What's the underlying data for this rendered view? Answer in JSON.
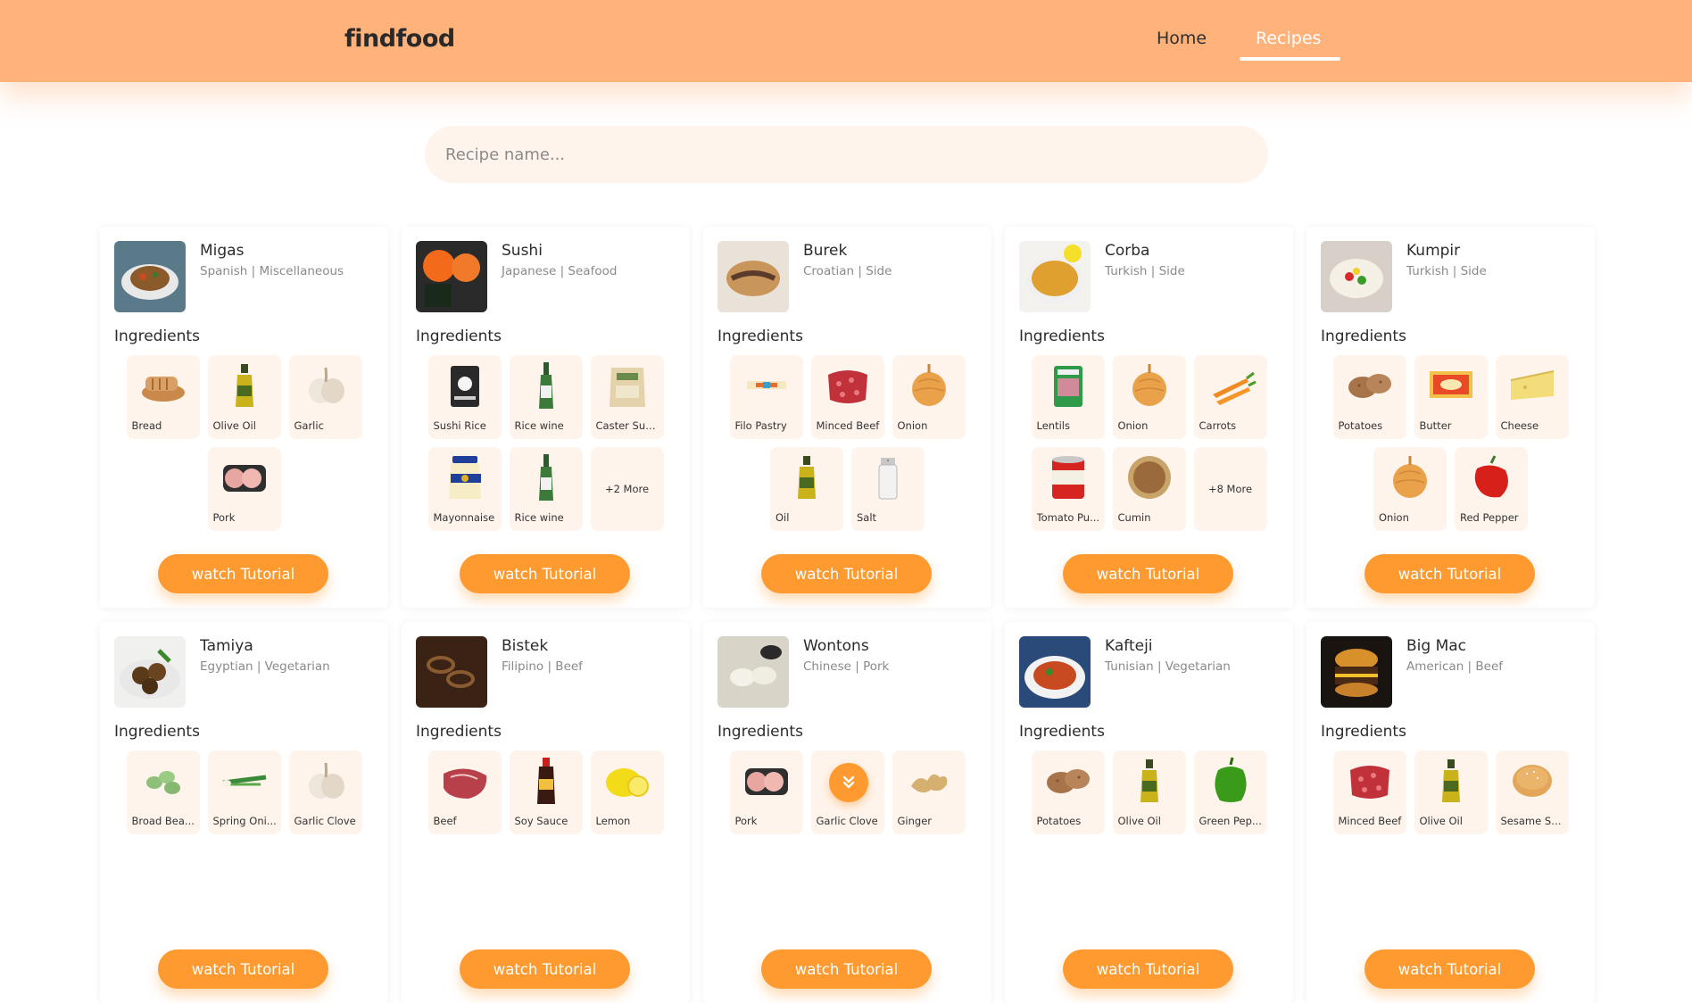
{
  "header": {
    "logo": "findfood",
    "nav": [
      {
        "label": "Home",
        "active": false
      },
      {
        "label": "Recipes",
        "active": true
      }
    ]
  },
  "search": {
    "placeholder": "Recipe name..."
  },
  "ingredients_heading": "Ingredients",
  "tutorial_label": "watch Tutorial",
  "recipes": [
    {
      "name": "Migas",
      "meta": "Spanish | Miscellaneous",
      "image": "migas-dish",
      "ingredients": [
        {
          "label": "Bread",
          "icon": "bread"
        },
        {
          "label": "Olive Oil",
          "icon": "olive-oil"
        },
        {
          "label": "Garlic",
          "icon": "garlic"
        },
        {
          "label": "Pork",
          "icon": "pork"
        }
      ]
    },
    {
      "name": "Sushi",
      "meta": "Japanese | Seafood",
      "image": "sushi-dish",
      "ingredients": [
        {
          "label": "Sushi Rice",
          "icon": "sushi-rice"
        },
        {
          "label": "Rice wine",
          "icon": "rice-wine"
        },
        {
          "label": "Caster Sug...",
          "icon": "sugar-bag"
        },
        {
          "label": "Mayonnaise",
          "icon": "mayonnaise"
        },
        {
          "label": "Rice wine",
          "icon": "rice-wine"
        },
        {
          "label": "+2 More",
          "icon": "more"
        }
      ]
    },
    {
      "name": "Burek",
      "meta": "Croatian | Side",
      "image": "burek-dish",
      "ingredients": [
        {
          "label": "Filo Pastry",
          "icon": "filo"
        },
        {
          "label": "Minced Beef",
          "icon": "minced-beef"
        },
        {
          "label": "Onion",
          "icon": "onion"
        },
        {
          "label": "Oil",
          "icon": "olive-oil"
        },
        {
          "label": "Salt",
          "icon": "salt"
        }
      ]
    },
    {
      "name": "Corba",
      "meta": "Turkish | Side",
      "image": "corba-dish",
      "ingredients": [
        {
          "label": "Lentils",
          "icon": "lentils"
        },
        {
          "label": "Onion",
          "icon": "onion"
        },
        {
          "label": "Carrots",
          "icon": "carrots"
        },
        {
          "label": "Tomato Pu...",
          "icon": "tomato-can"
        },
        {
          "label": "Cumin",
          "icon": "cumin"
        },
        {
          "label": "+8 More",
          "icon": "more"
        }
      ]
    },
    {
      "name": "Kumpir",
      "meta": "Turkish | Side",
      "image": "kumpir-dish",
      "ingredients": [
        {
          "label": "Potatoes",
          "icon": "potatoes"
        },
        {
          "label": "Butter",
          "icon": "butter"
        },
        {
          "label": "Cheese",
          "icon": "cheese"
        },
        {
          "label": "Onion",
          "icon": "onion"
        },
        {
          "label": "Red Pepper",
          "icon": "red-pepper"
        }
      ]
    },
    {
      "name": "Tamiya",
      "meta": "Egyptian | Vegetarian",
      "image": "tamiya-dish",
      "ingredients": [
        {
          "label": "Broad Bea...",
          "icon": "broad-beans"
        },
        {
          "label": "Spring Oni...",
          "icon": "spring-onion"
        },
        {
          "label": "Garlic Clove",
          "icon": "garlic"
        }
      ]
    },
    {
      "name": "Bistek",
      "meta": "Filipino | Beef",
      "image": "bistek-dish",
      "ingredients": [
        {
          "label": "Beef",
          "icon": "beef"
        },
        {
          "label": "Soy Sauce",
          "icon": "soy-sauce"
        },
        {
          "label": "Lemon",
          "icon": "lemon"
        }
      ]
    },
    {
      "name": "Wontons",
      "meta": "Chinese | Pork",
      "image": "wontons-dish",
      "ingredients": [
        {
          "label": "Pork",
          "icon": "pork"
        },
        {
          "label": "Garlic Clove",
          "icon": "garlic"
        },
        {
          "label": "Ginger",
          "icon": "ginger"
        }
      ]
    },
    {
      "name": "Kafteji",
      "meta": "Tunisian | Vegetarian",
      "image": "kafteji-dish",
      "ingredients": [
        {
          "label": "Potatoes",
          "icon": "potatoes"
        },
        {
          "label": "Olive Oil",
          "icon": "olive-oil"
        },
        {
          "label": "Green Pep...",
          "icon": "green-pepper"
        }
      ]
    },
    {
      "name": "Big Mac",
      "meta": "American | Beef",
      "image": "big-mac-dish",
      "ingredients": [
        {
          "label": "Minced Beef",
          "icon": "minced-beef"
        },
        {
          "label": "Olive Oil",
          "icon": "olive-oil"
        },
        {
          "label": "Sesame Se...",
          "icon": "sesame-bun"
        }
      ]
    }
  ],
  "scroll_button": {
    "icon": "chevrons-down-icon"
  },
  "colors": {
    "header": "#ffb27a",
    "accent": "#ff9a30",
    "tile": "#fff4ec"
  }
}
